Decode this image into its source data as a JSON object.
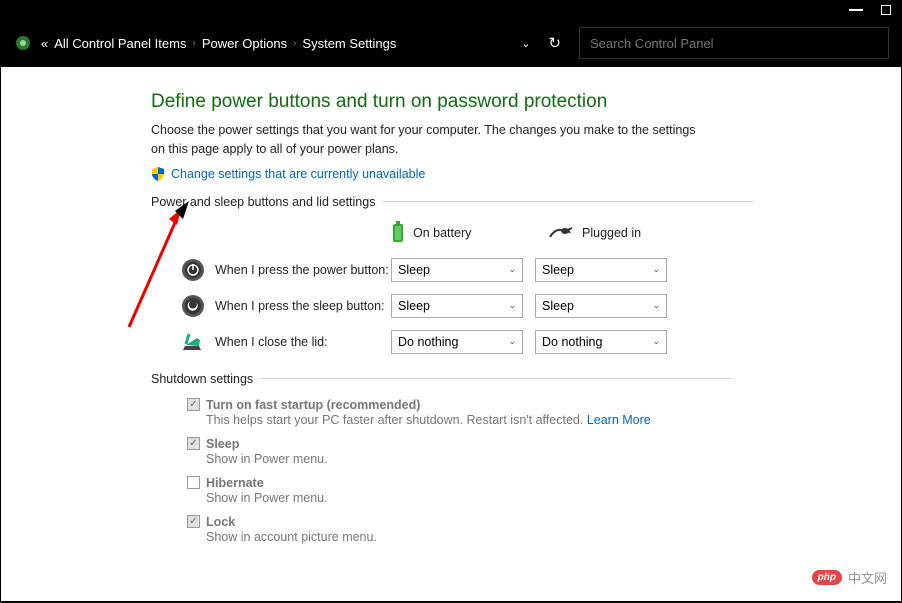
{
  "breadcrumb": {
    "prefix": "«",
    "items": [
      "All Control Panel Items",
      "Power Options",
      "System Settings"
    ]
  },
  "search": {
    "placeholder": "Search Control Panel"
  },
  "page": {
    "title": "Define power buttons and turn on password protection",
    "description": "Choose the power settings that you want for your computer. The changes you make to the settings on this page apply to all of your power plans.",
    "change_link": "Change settings that are currently unavailable"
  },
  "power_section": {
    "heading": "Power and sleep buttons and lid settings",
    "col_battery": "On battery",
    "col_plugged": "Plugged in",
    "rows": [
      {
        "label": "When I press the power button:",
        "battery": "Sleep",
        "plugged": "Sleep"
      },
      {
        "label": "When I press the sleep button:",
        "battery": "Sleep",
        "plugged": "Sleep"
      },
      {
        "label": "When I close the lid:",
        "battery": "Do nothing",
        "plugged": "Do nothing"
      }
    ]
  },
  "shutdown": {
    "heading": "Shutdown settings",
    "items": [
      {
        "label": "Turn on fast startup (recommended)",
        "desc": "This helps start your PC faster after shutdown. Restart isn't affected. ",
        "link": "Learn More",
        "checked": true
      },
      {
        "label": "Sleep",
        "desc": "Show in Power menu.",
        "checked": true
      },
      {
        "label": "Hibernate",
        "desc": "Show in Power menu.",
        "checked": false
      },
      {
        "label": "Lock",
        "desc": "Show in account picture menu.",
        "checked": true
      }
    ]
  },
  "watermark": {
    "badge": "php",
    "text": "中文网"
  }
}
